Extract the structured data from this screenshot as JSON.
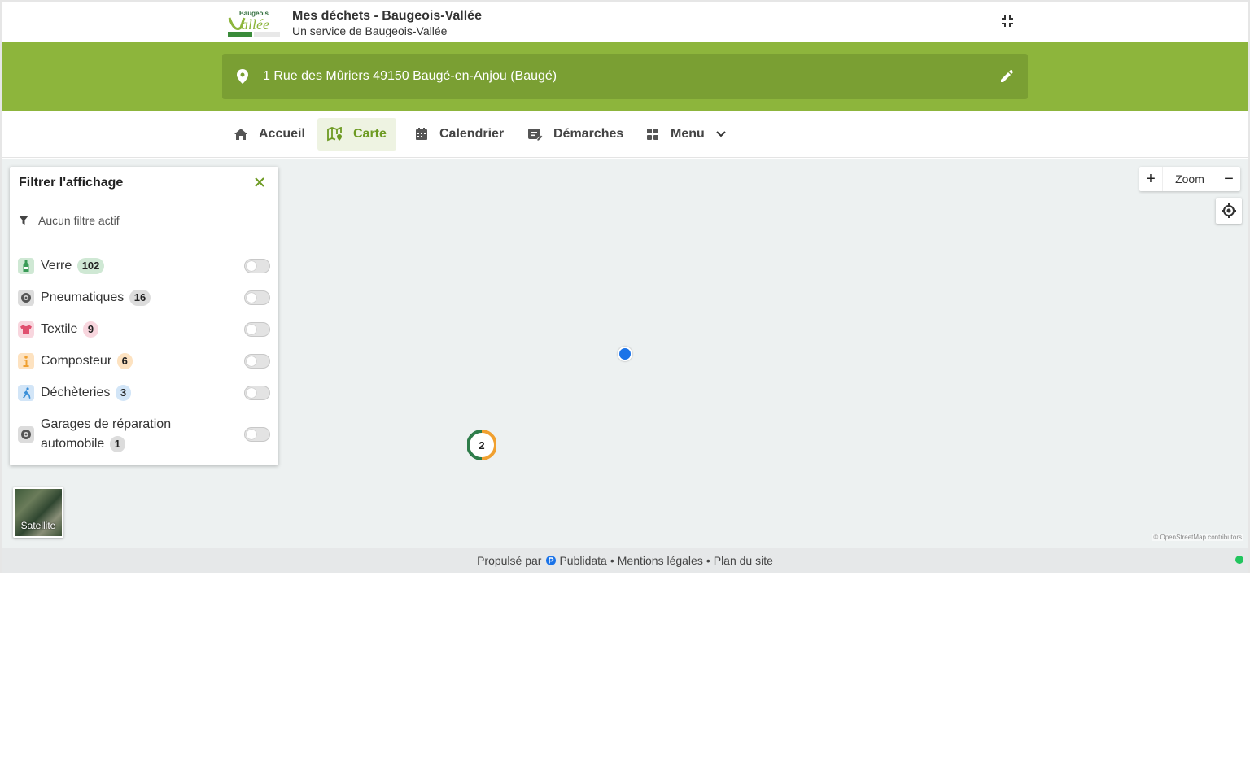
{
  "header": {
    "title": "Mes déchets - Baugeois-Vallée",
    "subtitle": "Un service de Baugeois-Vallée",
    "logo_text": "Baugeois Vallée"
  },
  "address": {
    "value": "1 Rue des Mûriers 49150 Baugé-en-Anjou (Baugé)"
  },
  "nav": {
    "items": [
      {
        "label": "Accueil",
        "icon": "home-icon"
      },
      {
        "label": "Carte",
        "icon": "map-icon",
        "active": true
      },
      {
        "label": "Calendrier",
        "icon": "calendar-icon"
      },
      {
        "label": "Démarches",
        "icon": "form-edit-icon"
      },
      {
        "label": "Menu",
        "icon": "grid-icon"
      }
    ]
  },
  "filter_panel": {
    "title": "Filtrer l'affichage",
    "status": "Aucun filtre actif",
    "categories": [
      {
        "label": "Verre",
        "count": "102",
        "icon": "bottle-icon",
        "color": "#3a9b57",
        "badge_color": "#cfe8d4",
        "enabled": false
      },
      {
        "label": "Pneumatiques",
        "count": "16",
        "icon": "tire-icon",
        "color": "#555555",
        "badge_color": "#dcdcdc",
        "enabled": false
      },
      {
        "label": "Textile",
        "count": "9",
        "icon": "tshirt-icon",
        "color": "#e0506f",
        "badge_color": "#f8d6de",
        "enabled": false
      },
      {
        "label": "Composteur",
        "count": "6",
        "icon": "compost-icon",
        "color": "#f0a030",
        "badge_color": "#fde2c0",
        "enabled": false
      },
      {
        "label": "Déchèteries",
        "count": "3",
        "icon": "recycling-center-icon",
        "color": "#3a8fd8",
        "badge_color": "#d2e5f7",
        "enabled": false
      },
      {
        "label": "Garages de réparation automobile",
        "count": "1",
        "icon": "tire-icon",
        "color": "#555555",
        "badge_color": "#dcdcdc",
        "enabled": false
      }
    ]
  },
  "map": {
    "zoom_label": "Zoom",
    "zoom_in": "+",
    "zoom_out": "−",
    "cluster_count": "2",
    "satellite_label": "Satellite",
    "attribution": "© OpenStreetMap contributors"
  },
  "footer": {
    "powered_by": "Propulsé par",
    "brand": "Publidata",
    "links": [
      "Mentions légales",
      "Plan du site"
    ],
    "separator": "•"
  },
  "colors": {
    "brand_green": "#8db53c",
    "address_bar": "#7a9f33",
    "active_nav": "#6d9a22",
    "user_location": "#1a73e8",
    "status_online": "#22c55e"
  }
}
